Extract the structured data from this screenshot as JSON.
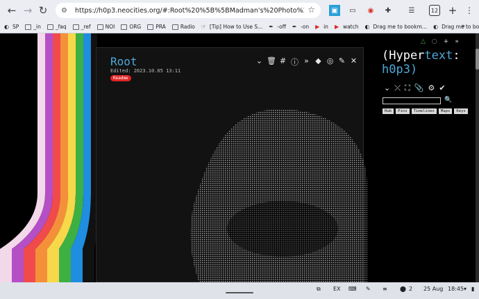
{
  "browser": {
    "url": "https://h0p3.neocities.org/#:Root%20%5B%5BMadman's%20Photo%20Slideshow%3A%20Walki...",
    "tab_count": "12",
    "bookmarks": [
      {
        "label": "SP",
        "icon": "globe-icon"
      },
      {
        "label": "_in",
        "icon": "folder-icon"
      },
      {
        "label": "_faq",
        "icon": "folder-icon"
      },
      {
        "label": "_ref",
        "icon": "folder-icon"
      },
      {
        "label": "NOI",
        "icon": "folder-icon"
      },
      {
        "label": "ORG",
        "icon": "folder-icon"
      },
      {
        "label": "PRA",
        "icon": "folder-icon"
      },
      {
        "label": "Radio",
        "icon": "folder-icon"
      },
      {
        "label": "[Tip] How to Use S...",
        "icon": "tip-icon"
      },
      {
        "label": "-off",
        "icon": "pen-icon"
      },
      {
        "label": "-on",
        "icon": "pen-icon"
      },
      {
        "label": "in",
        "icon": "youtube-icon"
      },
      {
        "label": "watch",
        "icon": "youtube-icon"
      },
      {
        "label": "Drag me to bookm...",
        "icon": "globe-icon"
      },
      {
        "label": "Drag me to bookm...",
        "icon": "globe-icon"
      }
    ]
  },
  "tiddler": {
    "title": "Root",
    "edited": "Edited: 2023.10.05 13:11",
    "badge": "Readme"
  },
  "sidebar": {
    "title_open": "(Hyper",
    "title_mid": "text",
    "title_close": ":",
    "title_site": "h0p3)",
    "tabs": [
      "Hub",
      "Pins",
      "Timelines",
      "Maps",
      "Keys"
    ]
  },
  "shelf": {
    "keyboard": "EX",
    "date": "25 Aug",
    "time": "18:45",
    "notifications": "2"
  },
  "colors": {
    "accent": "#4ea8d8",
    "badge": "#e02424",
    "stripes": [
      "#f3d8ea",
      "#b44fc6",
      "#f04a4a",
      "#f5903a",
      "#f7d84a",
      "#3cb043",
      "#1f8de0",
      "#111111"
    ]
  }
}
